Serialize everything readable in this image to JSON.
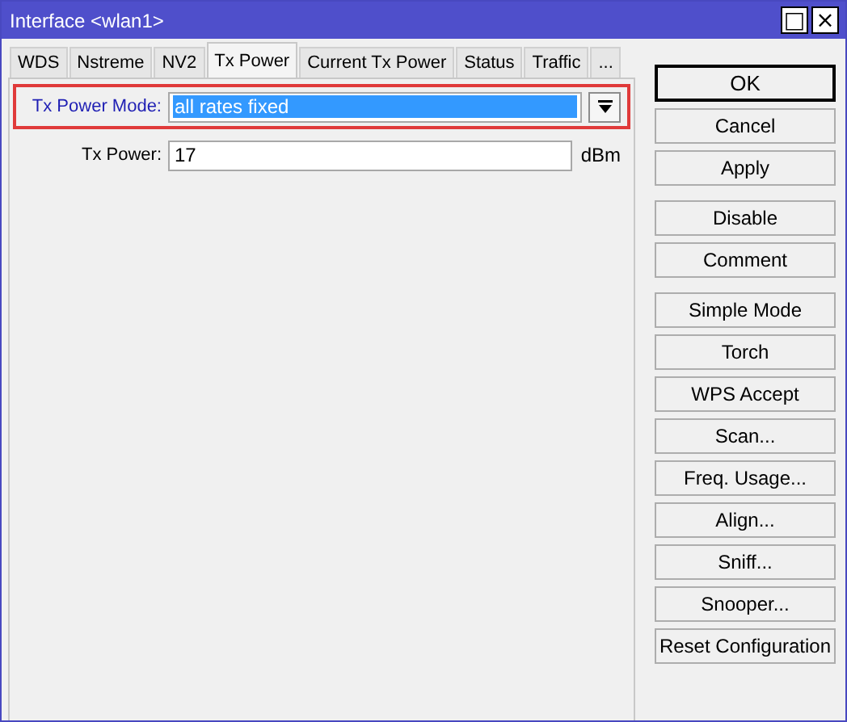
{
  "window": {
    "title": "Interface <wlan1>",
    "controls": [
      "□",
      "×"
    ]
  },
  "tabs": [
    {
      "label": "WDS",
      "selected": false
    },
    {
      "label": "Nstreme",
      "selected": false
    },
    {
      "label": "NV2",
      "selected": false
    },
    {
      "label": "Tx Power",
      "selected": true
    },
    {
      "label": "Current Tx Power",
      "selected": false
    },
    {
      "label": "Status",
      "selected": false
    },
    {
      "label": "Traffic",
      "selected": false
    },
    {
      "label": "...",
      "selected": false
    }
  ],
  "fields": [
    {
      "kind": "select",
      "label": "Tx Power Mode:",
      "value": "all rates fixed",
      "highlighted": true,
      "text_selected": true
    },
    {
      "kind": "text",
      "label": "Tx Power:",
      "value": "17",
      "unit": "dBm",
      "highlighted": false,
      "text_selected": false
    }
  ],
  "button_groups": [
    [
      {
        "label": "OK",
        "default": true
      },
      {
        "label": "Cancel",
        "default": false
      },
      {
        "label": "Apply",
        "default": false
      }
    ],
    [
      {
        "label": "Disable",
        "default": false
      },
      {
        "label": "Comment",
        "default": false
      }
    ],
    [
      {
        "label": "Simple Mode",
        "default": false
      },
      {
        "label": "Torch",
        "default": false
      },
      {
        "label": "WPS Accept",
        "default": false
      },
      {
        "label": "Scan...",
        "default": false
      },
      {
        "label": "Freq. Usage...",
        "default": false
      },
      {
        "label": "Align...",
        "default": false
      },
      {
        "label": "Sniff...",
        "default": false
      },
      {
        "label": "Snooper...",
        "default": false
      },
      {
        "label": "Reset Configuration",
        "default": false
      }
    ]
  ]
}
